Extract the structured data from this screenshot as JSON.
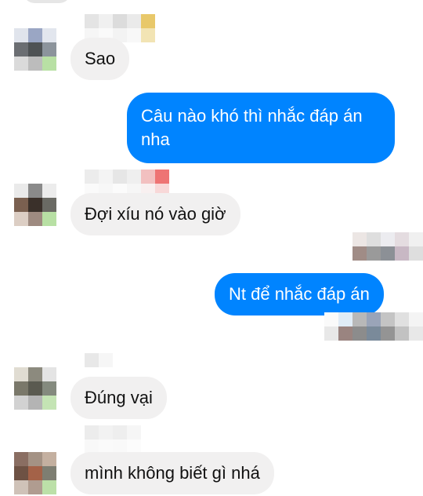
{
  "messages": [
    {
      "id": "m1",
      "direction": "incoming",
      "text": "Sao"
    },
    {
      "id": "m2",
      "direction": "outgoing",
      "text": "Câu nào khó thì nhắc đáp án nha"
    },
    {
      "id": "m3",
      "direction": "incoming",
      "text": "Đợi xíu nó vào giờ"
    },
    {
      "id": "m4",
      "direction": "outgoing",
      "text": "Nt để nhắc đáp án"
    },
    {
      "id": "m5",
      "direction": "incoming",
      "text": "Đúng vại"
    },
    {
      "id": "m6",
      "direction": "incoming",
      "text": "mình không biết gì nhá"
    }
  ],
  "colors": {
    "outgoing_bubble": "#0084ff",
    "incoming_bubble": "#f1f0f0",
    "incoming_text": "#111111",
    "outgoing_text": "#ffffff"
  }
}
